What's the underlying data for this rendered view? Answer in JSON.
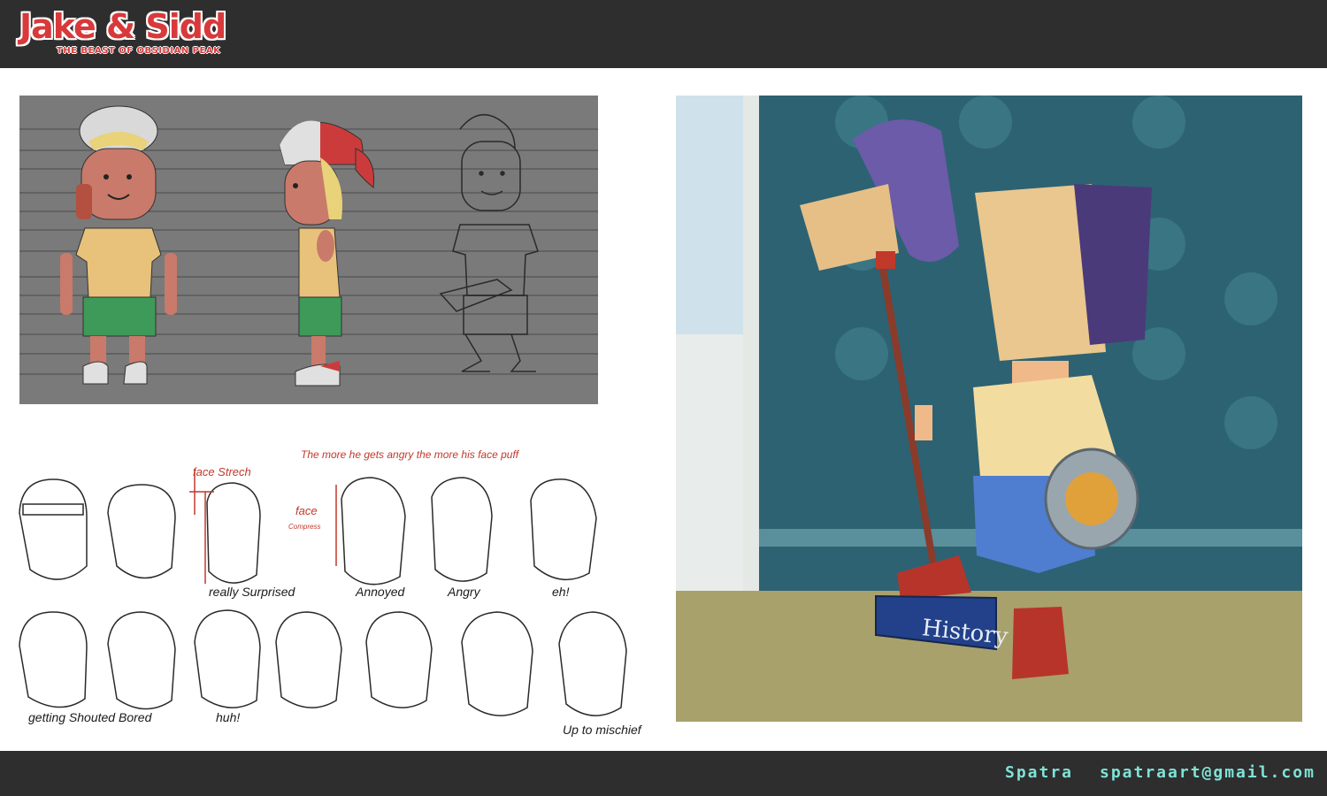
{
  "header": {
    "title": "Jake & Sidd",
    "subtitle": "THE BEAST OF OBSIDIAN PEAK"
  },
  "expression_notes": {
    "annotation_angry": "The more he gets angry the more his face puff",
    "face_strech": "face Strech",
    "face_compress": "face",
    "compress_small": "Compress",
    "labels": {
      "really_surprised": "really Surprised",
      "annoyed": "Annoyed",
      "angry": "Angry",
      "eh": "eh!",
      "getting_shouted": "getting Shouted",
      "bored": "Bored",
      "huh": "huh!",
      "up_to_mischief": "Up to mischief"
    }
  },
  "painting": {
    "book_title": "History"
  },
  "footer": {
    "artist": "Spatra",
    "email": "spatraart@gmail.com"
  },
  "colors": {
    "bar": "#2e2e2e",
    "title_red": "#d8393b",
    "credit_teal": "#7fe3d6",
    "sheet_gray": "#7a7a7a"
  }
}
